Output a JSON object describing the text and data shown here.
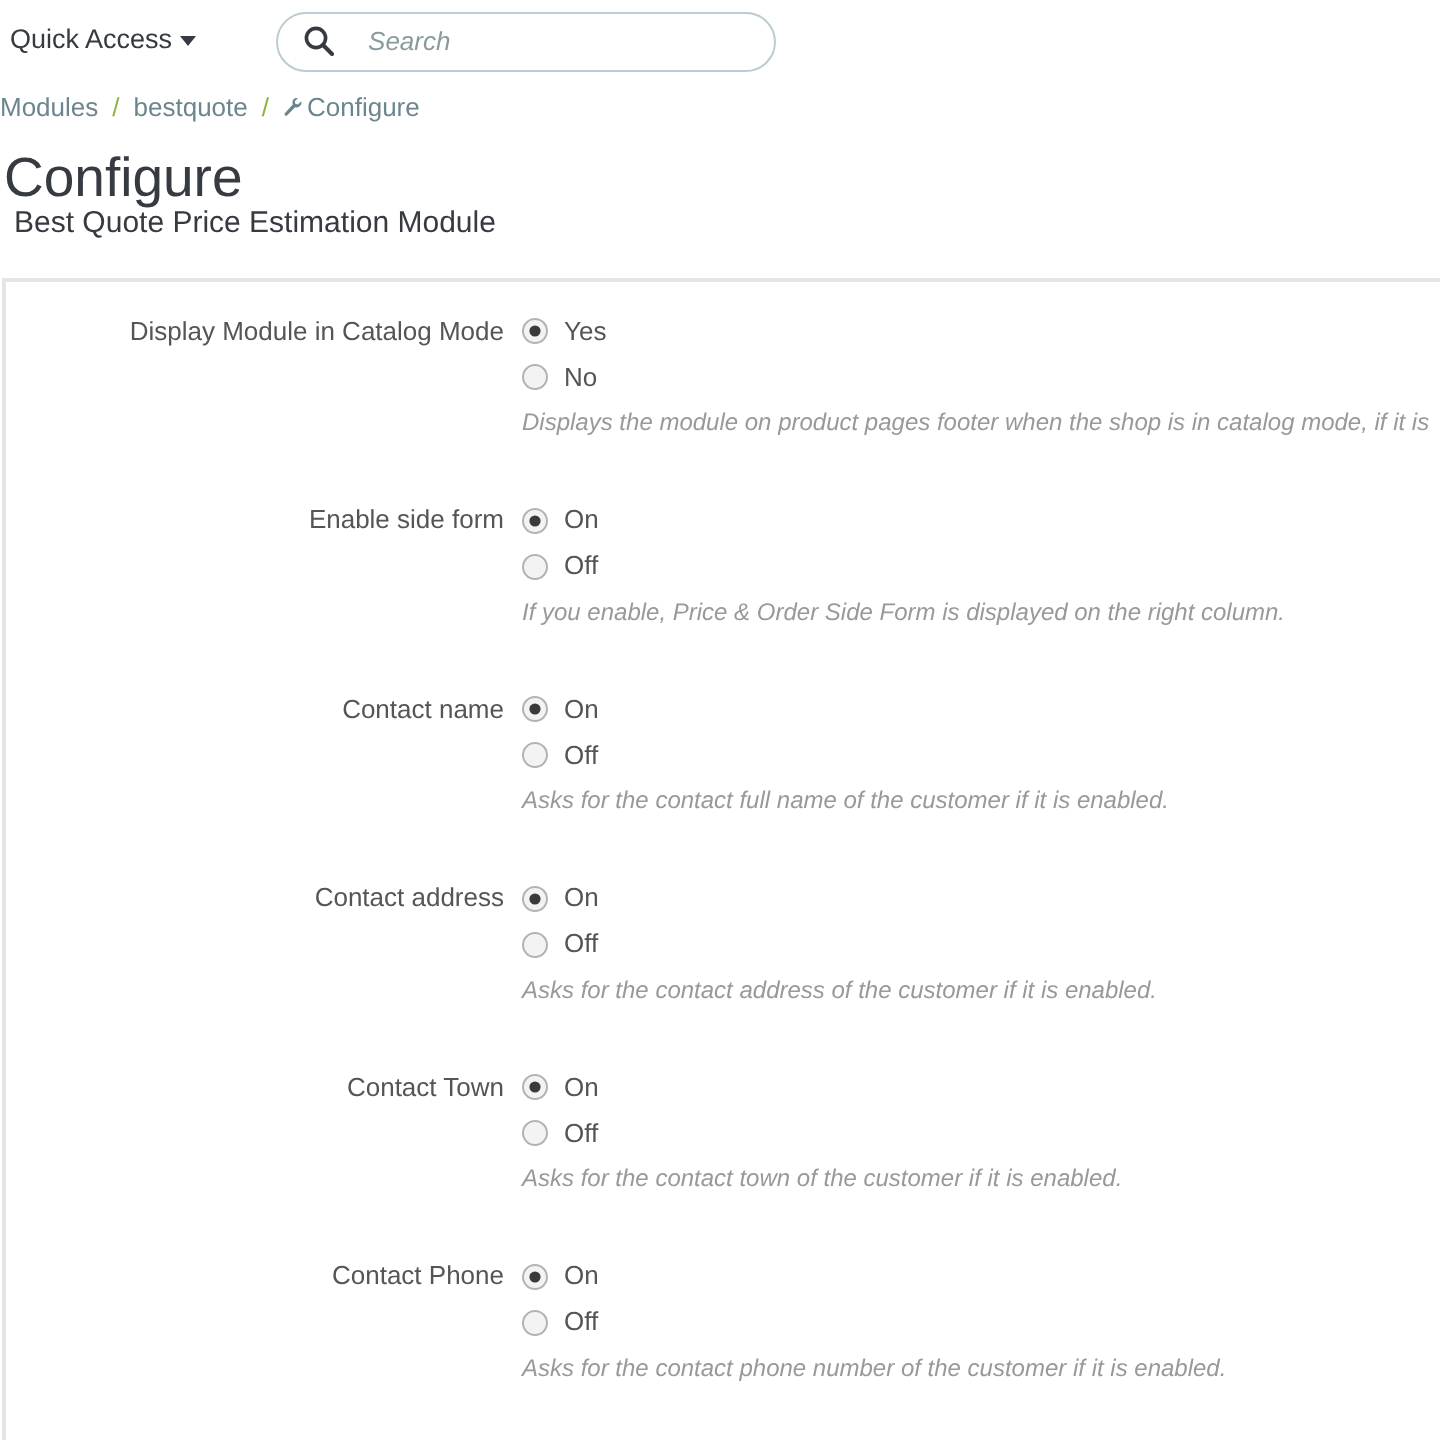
{
  "top_bar": {
    "quick_access": {
      "label": "Quick Access"
    },
    "search": {
      "placeholder": "Search"
    }
  },
  "breadcrumb": [
    {
      "label": "Modules",
      "kind": "link",
      "separator": "/"
    },
    {
      "label": "bestquote",
      "kind": "link",
      "separator": "/"
    },
    {
      "label": "Configure",
      "kind": "current"
    }
  ],
  "header": {
    "title": "Configure",
    "subtitle": "Best Quote Price Estimation Module"
  },
  "settings": [
    {
      "label": "Display Module in Catalog Mode",
      "options": [
        {
          "label": "Yes",
          "selected": true
        },
        {
          "label": "No",
          "selected": false
        }
      ],
      "help": "Displays the module on product pages footer when the shop is in catalog mode, if it is"
    },
    {
      "label": "Enable side form",
      "options": [
        {
          "label": "On",
          "selected": true
        },
        {
          "label": "Off",
          "selected": false
        }
      ],
      "help": "If you enable, Price & Order Side Form is displayed on the right column."
    },
    {
      "label": "Contact name",
      "options": [
        {
          "label": "On",
          "selected": true
        },
        {
          "label": "Off",
          "selected": false
        }
      ],
      "help": "Asks for the contact full name of the customer if it is enabled."
    },
    {
      "label": "Contact address",
      "options": [
        {
          "label": "On",
          "selected": true
        },
        {
          "label": "Off",
          "selected": false
        }
      ],
      "help": "Asks for the contact address of the customer if it is enabled."
    },
    {
      "label": "Contact Town",
      "options": [
        {
          "label": "On",
          "selected": true
        },
        {
          "label": "Off",
          "selected": false
        }
      ],
      "help": "Asks for the contact town of the customer if it is enabled."
    },
    {
      "label": "Contact Phone",
      "options": [
        {
          "label": "On",
          "selected": true
        },
        {
          "label": "Off",
          "selected": false
        }
      ],
      "help": "Asks for the contact phone number of the customer if it is enabled."
    }
  ]
}
